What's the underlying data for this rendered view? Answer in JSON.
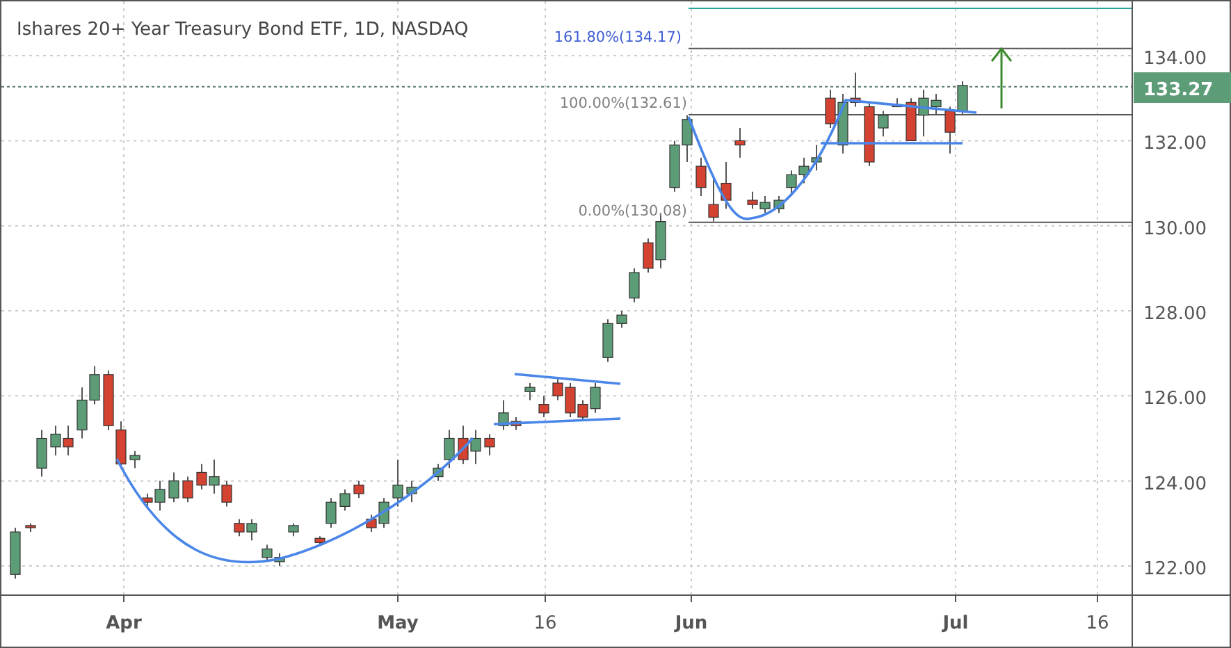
{
  "title": "Ishares 20+ Year Treasury Bond ETF, 1D, NASDAQ",
  "fibonacci_levels": [
    {
      "label": "161.80%(134.17)",
      "color": "#3f5fd6"
    },
    {
      "label": "100.00%(132.61)",
      "color": "#808080"
    },
    {
      "label": "0.00%(130.08)",
      "color": "#808080"
    }
  ],
  "price_axis": [
    "134.00",
    "132.00",
    "130.00",
    "128.00",
    "126.00",
    "124.00",
    "122.00"
  ],
  "current_price": "133.27",
  "date_axis": [
    {
      "label": "Apr",
      "kind": "month"
    },
    {
      "label": "May",
      "kind": "month"
    },
    {
      "label": "16",
      "kind": "day"
    },
    {
      "label": "Jun",
      "kind": "month"
    },
    {
      "label": "Jul",
      "kind": "month"
    },
    {
      "label": "16",
      "kind": "day"
    }
  ]
}
